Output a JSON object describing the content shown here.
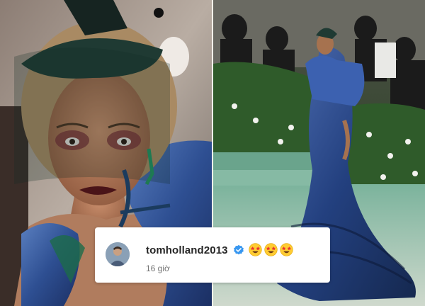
{
  "comment": {
    "username": "tomholland2013",
    "time": "16 giờ",
    "emojis": [
      "star-struck-emoji",
      "star-struck-emoji",
      "star-struck-emoji"
    ]
  },
  "colors": {
    "card_bg": "#ffffff",
    "username": "#262626",
    "time": "#737373",
    "verified_badge": "#3897f0",
    "gown_blue": "#2c4a8a"
  },
  "icons": {
    "verified": "verified-badge-icon",
    "avatar": "avatar"
  }
}
